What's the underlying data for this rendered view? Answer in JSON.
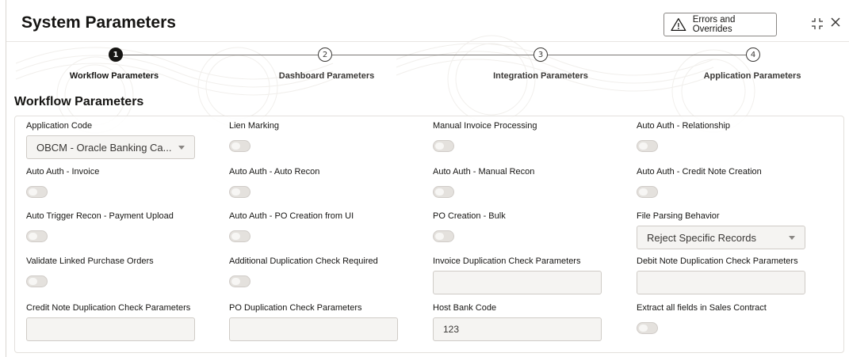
{
  "header": {
    "title": "System Parameters",
    "errors_button_label": "Errors and Overrides"
  },
  "stepper": {
    "steps": [
      {
        "number": "1",
        "label": "Workflow Parameters",
        "state": "active"
      },
      {
        "number": "2",
        "label": "Dashboard Parameters",
        "state": "pending"
      },
      {
        "number": "3",
        "label": "Integration Parameters",
        "state": "pending"
      },
      {
        "number": "4",
        "label": "Application Parameters",
        "state": "pending"
      }
    ]
  },
  "section": {
    "title": "Workflow Parameters"
  },
  "fields": {
    "application_code": {
      "label": "Application Code",
      "value": "OBCM - Oracle Banking Ca..."
    },
    "lien_marking": {
      "label": "Lien Marking",
      "on": false
    },
    "manual_invoice_processing": {
      "label": "Manual Invoice Processing",
      "on": false
    },
    "auto_auth_relationship": {
      "label": "Auto Auth - Relationship",
      "on": false
    },
    "auto_auth_invoice": {
      "label": "Auto Auth - Invoice",
      "on": false
    },
    "auto_auth_auto_recon": {
      "label": "Auto Auth - Auto Recon",
      "on": false
    },
    "auto_auth_manual_recon": {
      "label": "Auto Auth - Manual Recon",
      "on": false
    },
    "auto_auth_credit_note": {
      "label": "Auto Auth - Credit Note Creation",
      "on": false
    },
    "auto_trigger_recon": {
      "label": "Auto Trigger Recon - Payment Upload",
      "on": false
    },
    "auto_auth_po_creation": {
      "label": "Auto Auth - PO Creation from UI",
      "on": false
    },
    "po_creation_bulk": {
      "label": "PO Creation - Bulk",
      "on": false
    },
    "file_parsing_behavior": {
      "label": "File Parsing Behavior",
      "value": "Reject Specific Records"
    },
    "validate_linked_po": {
      "label": "Validate Linked Purchase Orders",
      "on": false
    },
    "additional_duplication_check": {
      "label": "Additional Duplication Check Required",
      "on": false
    },
    "invoice_duplication_params": {
      "label": "Invoice Duplication Check Parameters",
      "value": ""
    },
    "debit_note_duplication_params": {
      "label": "Debit Note Duplication Check Parameters",
      "value": ""
    },
    "credit_note_duplication_params": {
      "label": "Credit Note Duplication Check Parameters",
      "value": ""
    },
    "po_duplication_params": {
      "label": "PO Duplication Check Parameters",
      "value": ""
    },
    "host_bank_code": {
      "label": "Host Bank Code",
      "value": "123"
    },
    "extract_all_fields_sales_contract": {
      "label": "Extract all fields in Sales Contract",
      "on": false
    }
  },
  "icons": {
    "warning": "warning-triangle-icon",
    "collapse": "collapse-icon",
    "close": "close-icon",
    "dropdown": "chevron-down-icon"
  }
}
